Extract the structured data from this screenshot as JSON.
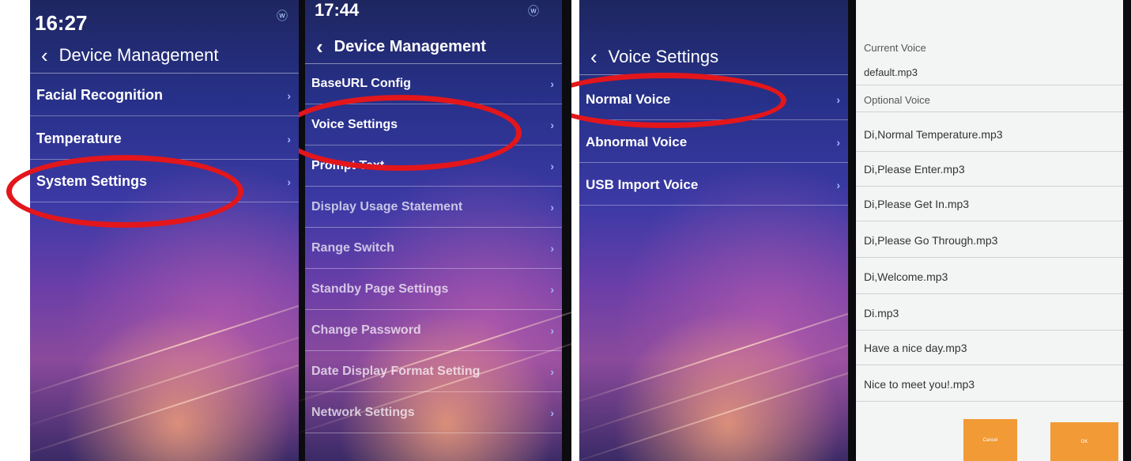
{
  "panel1": {
    "time": "16:27",
    "title": "Device Management",
    "items": [
      "Facial Recognition",
      "Temperature",
      "System Settings"
    ]
  },
  "panel2": {
    "time": "17:44",
    "title": "Device Management",
    "items": [
      "BaseURL Config",
      "Voice Settings",
      "Prompt Text",
      "Display Usage Statement",
      "Range Switch",
      "Standby Page Settings",
      "Change Password",
      "Date Display Format Setting",
      "Network Settings"
    ]
  },
  "panel3": {
    "title": "Voice Settings",
    "items": [
      "Normal Voice",
      "Abnormal Voice",
      "USB Import Voice"
    ]
  },
  "panel4": {
    "current_label": "Current Voice",
    "current_value": "default.mp3",
    "optional_label": "Optional Voice",
    "options": [
      "Di,Normal Temperature.mp3",
      "Di,Please Enter.mp3",
      "Di,Please Get  In.mp3",
      "Di,Please Go Through.mp3",
      "Di,Welcome.mp3",
      "Di.mp3",
      "Have a nice day.mp3",
      "Nice to meet you!.mp3"
    ],
    "cancel_label": "Cancel",
    "ok_label": "OK"
  },
  "colors": {
    "highlight_oval": "#e3161b",
    "button_orange": "#f29a35"
  },
  "icons": [
    "wifi-icon",
    "back-chevron-icon",
    "chevron-right-icon"
  ]
}
